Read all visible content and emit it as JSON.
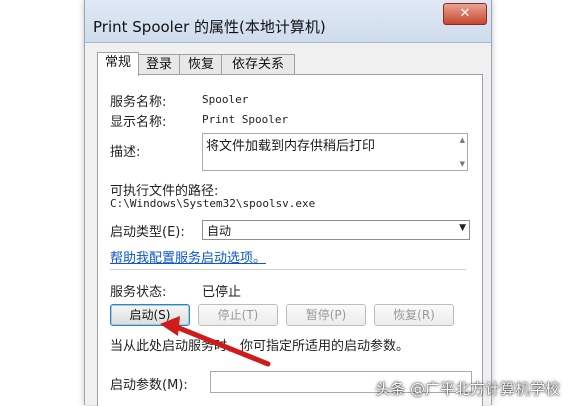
{
  "window": {
    "title": "Print Spooler 的属性(本地计算机)",
    "close_icon": "✕"
  },
  "tabs": [
    {
      "label": "常规",
      "active": true
    },
    {
      "label": "登录",
      "active": false
    },
    {
      "label": "恢复",
      "active": false
    },
    {
      "label": "依存关系",
      "active": false
    }
  ],
  "general": {
    "service_name_label": "服务名称:",
    "service_name": "Spooler",
    "display_name_label": "显示名称:",
    "display_name": "Print Spooler",
    "description_label": "描述:",
    "description": "将文件加载到内存供稍后打印",
    "exe_path_label": "可执行文件的路径:",
    "exe_path": "C:\\Windows\\System32\\spoolsv.exe",
    "startup_type_label": "启动类型(E):",
    "startup_type_value": "自动",
    "help_link": "帮助我配置服务启动选项。",
    "status_label": "服务状态:",
    "status_value": "已停止",
    "buttons": {
      "start": "启动(S)",
      "stop": "停止(T)",
      "pause": "暂停(P)",
      "resume": "恢复(R)"
    },
    "hint": "当从此处启动服务时，你可指定所适用的启动参数。",
    "start_params_label": "启动参数(M):",
    "start_params_value": ""
  },
  "watermark": "头条 @广平北方计算机学校",
  "colors": {
    "link": "#0b56c8",
    "arrow": "#d11a1a",
    "titlebar": "#dfe9f5"
  }
}
